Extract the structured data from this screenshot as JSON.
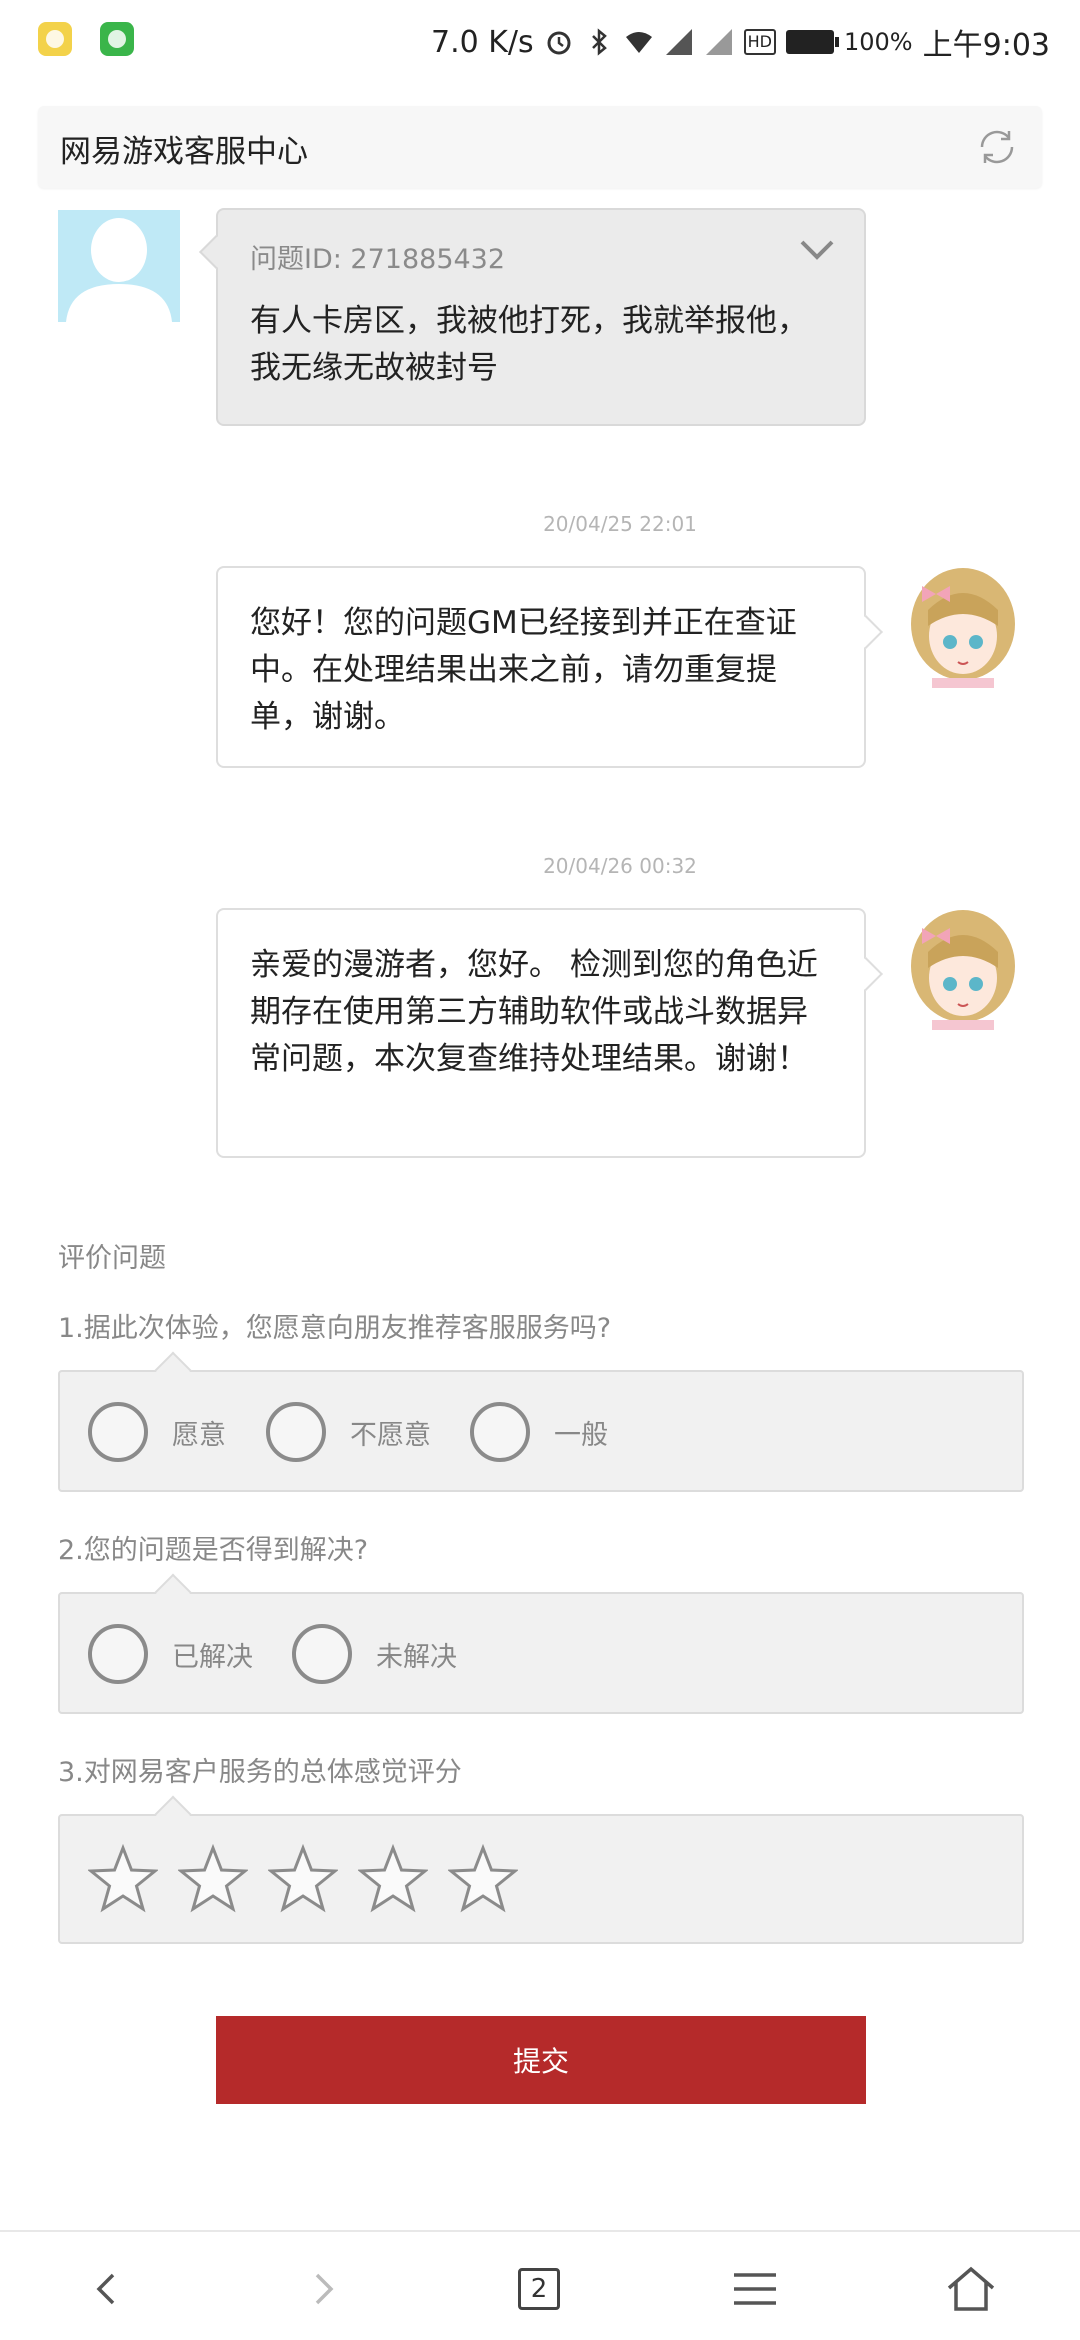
{
  "status_bar": {
    "net_speed": "7.0 K/s",
    "battery": "100%",
    "time": "上午9:03",
    "hd_badge": "HD"
  },
  "header": {
    "title": "网易游戏客服中心"
  },
  "messages": [
    {
      "question_id": "问题ID: 271885432",
      "text": "有人卡房区，我被他打死，我就举报他，我无缘无故被封号"
    },
    {
      "timestamp": "20/04/25 22:01",
      "text": "您好！您的问题GM已经接到并正在查证中。在处理结果出来之前，请勿重复提单，谢谢。"
    },
    {
      "timestamp": "20/04/26 00:32",
      "text": "亲爱的漫游者，您好。 检测到您的角色近期存在使用第三方辅助软件或战斗数据异常问题，本次复查维持处理结果。谢谢！"
    }
  ],
  "rating": {
    "title": "评价问题",
    "q1": {
      "label": "1.据此次体验，您愿意向朋友推荐客服服务吗?",
      "options": [
        "愿意",
        "不愿意",
        "一般"
      ]
    },
    "q2": {
      "label": "2.您的问题是否得到解决?",
      "options": [
        "已解决",
        "未解决"
      ]
    },
    "q3": {
      "label": "3.对网易客户服务的总体感觉评分",
      "stars": 0,
      "max_stars": 5
    }
  },
  "submit_label": "提交",
  "bottom_nav": {
    "tab_count": "2"
  },
  "colors": {
    "accent": "#b52a2a",
    "user_avatar_bg": "#bfe9f6"
  }
}
